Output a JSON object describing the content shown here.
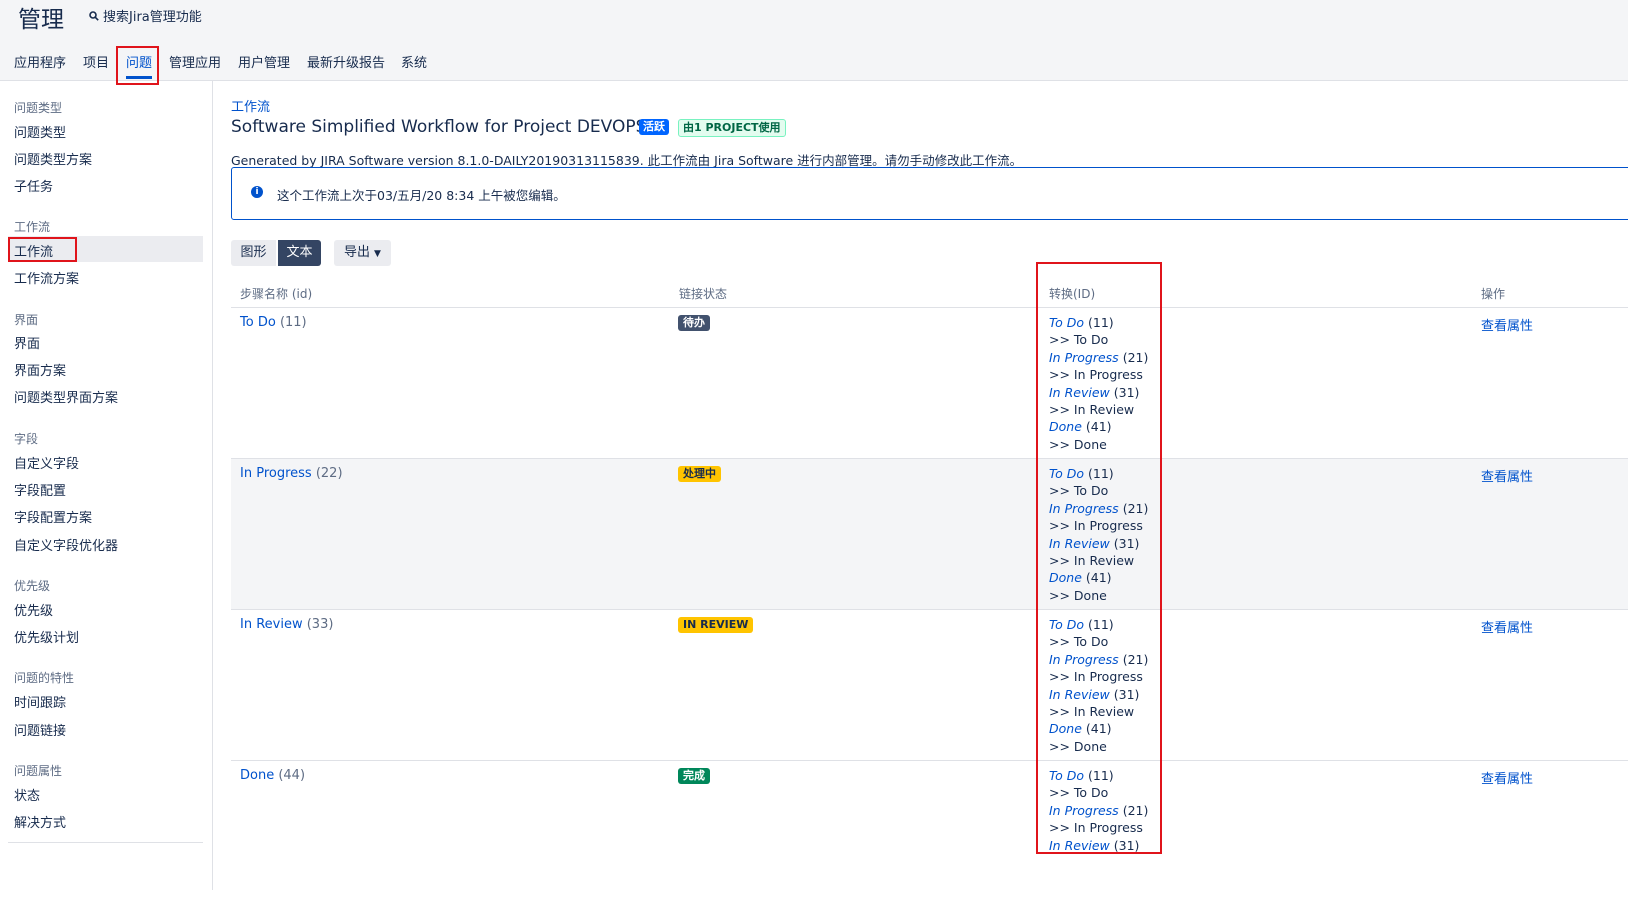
{
  "header": {
    "title": "管理",
    "search_label": "搜索Jira管理功能"
  },
  "nav": {
    "items": [
      "应用程序",
      "项目",
      "问题",
      "管理应用",
      "用户管理",
      "最新升级报告",
      "系统"
    ]
  },
  "sidebar": {
    "groups": [
      {
        "heading": "问题类型",
        "items": [
          "问题类型",
          "问题类型方案",
          "子任务"
        ]
      },
      {
        "heading": "工作流",
        "items": [
          "工作流",
          "工作流方案"
        ]
      },
      {
        "heading": "界面",
        "items": [
          "界面",
          "界面方案",
          "问题类型界面方案"
        ]
      },
      {
        "heading": "字段",
        "items": [
          "自定义字段",
          "字段配置",
          "字段配置方案",
          "自定义字段优化器"
        ]
      },
      {
        "heading": "优先级",
        "items": [
          "优先级",
          "优先级计划"
        ]
      },
      {
        "heading": "问题的特性",
        "items": [
          "时间跟踪",
          "问题链接"
        ]
      },
      {
        "heading": "问题属性",
        "items": [
          "状态",
          "解决方式"
        ]
      }
    ]
  },
  "page": {
    "breadcrumb": "工作流",
    "title": "Software Simplified Workflow for Project DEVOPS",
    "badge_active": "活跃",
    "badge_used": "由1 PROJECT使用",
    "description": "Generated by JIRA Software version 8.1.0-DAILY20190313115839. 此工作流由 Jira Software 进行内部管理。请勿手动修改此工作流。",
    "info_icon": "info-icon",
    "info_text": "这个工作流上次于03/五月/20 8:34 上午被您编辑。"
  },
  "toolbar": {
    "graph_label": "图形",
    "text_label": "文本",
    "export_label": "导出"
  },
  "table": {
    "headers": {
      "step": "步骤名称 (id)",
      "status": "链接状态",
      "transitions": "转换(ID)",
      "actions": "操作"
    },
    "rows": [
      {
        "step": "To Do",
        "step_id": "(11)",
        "status": "待办",
        "status_bg": "#42526e",
        "status_fg": "#ffffff",
        "action": "查看属性",
        "transitions": [
          {
            "name": "To Do",
            "id": "(11)",
            "target": ">> To Do"
          },
          {
            "name": "In Progress",
            "id": "(21)",
            "target": ">> In Progress"
          },
          {
            "name": "In Review",
            "id": "(31)",
            "target": ">> In Review"
          },
          {
            "name": "Done",
            "id": "(41)",
            "target": ">> Done"
          }
        ]
      },
      {
        "step": "In Progress",
        "step_id": "(22)",
        "status": "处理中",
        "status_bg": "#ffc400",
        "status_fg": "#172b4d",
        "action": "查看属性",
        "transitions": [
          {
            "name": "To Do",
            "id": "(11)",
            "target": ">> To Do"
          },
          {
            "name": "In Progress",
            "id": "(21)",
            "target": ">> In Progress"
          },
          {
            "name": "In Review",
            "id": "(31)",
            "target": ">> In Review"
          },
          {
            "name": "Done",
            "id": "(41)",
            "target": ">> Done"
          }
        ]
      },
      {
        "step": "In Review",
        "step_id": "(33)",
        "status": "IN REVIEW",
        "status_bg": "#ffc400",
        "status_fg": "#172b4d",
        "action": "查看属性",
        "transitions": [
          {
            "name": "To Do",
            "id": "(11)",
            "target": ">> To Do"
          },
          {
            "name": "In Progress",
            "id": "(21)",
            "target": ">> In Progress"
          },
          {
            "name": "In Review",
            "id": "(31)",
            "target": ">> In Review"
          },
          {
            "name": "Done",
            "id": "(41)",
            "target": ">> Done"
          }
        ]
      },
      {
        "step": "Done",
        "step_id": "(44)",
        "status": "完成",
        "status_bg": "#00875a",
        "status_fg": "#ffffff",
        "action": "查看属性",
        "transitions": [
          {
            "name": "To Do",
            "id": "(11)",
            "target": ">> To Do"
          },
          {
            "name": "In Progress",
            "id": "(21)",
            "target": ">> In Progress"
          },
          {
            "name": "In Review",
            "id": "(31)"
          }
        ]
      }
    ]
  }
}
